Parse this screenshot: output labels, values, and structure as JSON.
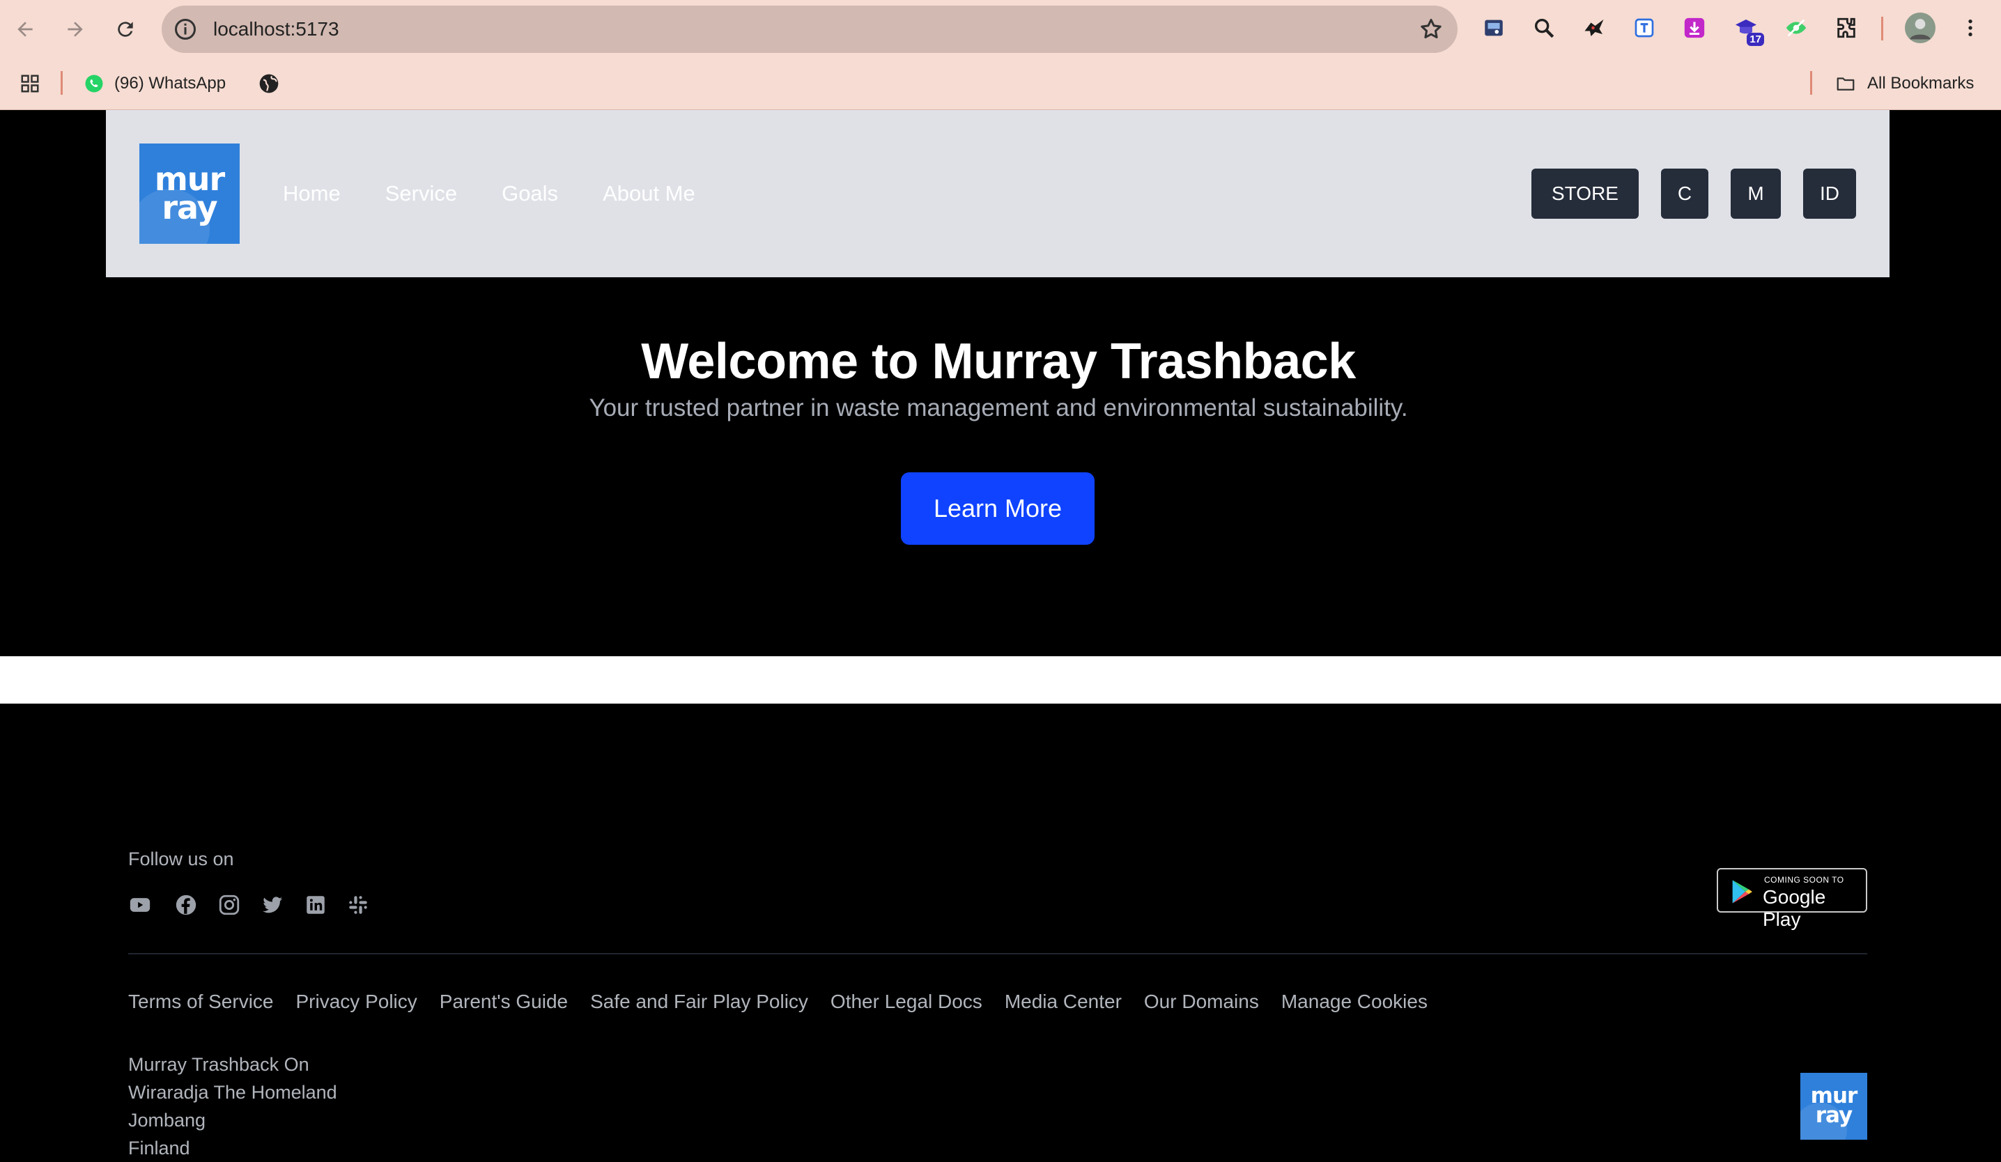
{
  "browser": {
    "url": "localhost:5173",
    "extension_badge": "17",
    "bookmarks": [
      {
        "label": "(96) WhatsApp",
        "icon": "whatsapp-icon"
      },
      {
        "label": "",
        "icon": "globe-icon"
      }
    ],
    "all_bookmarks_label": "All Bookmarks"
  },
  "header": {
    "logo_line1": "mur",
    "logo_line2": "ray",
    "nav": [
      "Home",
      "Service",
      "Goals",
      "About Me"
    ],
    "buttons": {
      "store": "STORE",
      "c": "C",
      "m": "M",
      "id": "ID"
    }
  },
  "hero": {
    "title": "Welcome to Murray Trashback",
    "subtitle": "Your trusted partner in waste management and environmental sustainability.",
    "cta": "Learn More"
  },
  "footer": {
    "follow_label": "Follow us on",
    "social_icons": [
      "youtube-icon",
      "facebook-icon",
      "instagram-icon",
      "twitter-icon",
      "linkedin-icon",
      "slack-icon"
    ],
    "store_badge": {
      "small": "COMING SOON TO",
      "big": "Google Play"
    },
    "links": [
      "Terms of Service",
      "Privacy Policy",
      "Parent's Guide",
      "Safe and Fair Play Policy",
      "Other Legal Docs",
      "Media Center",
      "Our Domains",
      "Manage Cookies"
    ],
    "address": [
      "Murray Trashback On",
      "Wiraradja The Homeland",
      "Jombang",
      "Finland"
    ]
  },
  "colors": {
    "chrome_bg": "#f6dcd2",
    "header_bg": "#dfe1e7",
    "brand_blue": "#2f80db",
    "cta_blue": "#0f43ff",
    "dark_button": "#252c3a"
  }
}
